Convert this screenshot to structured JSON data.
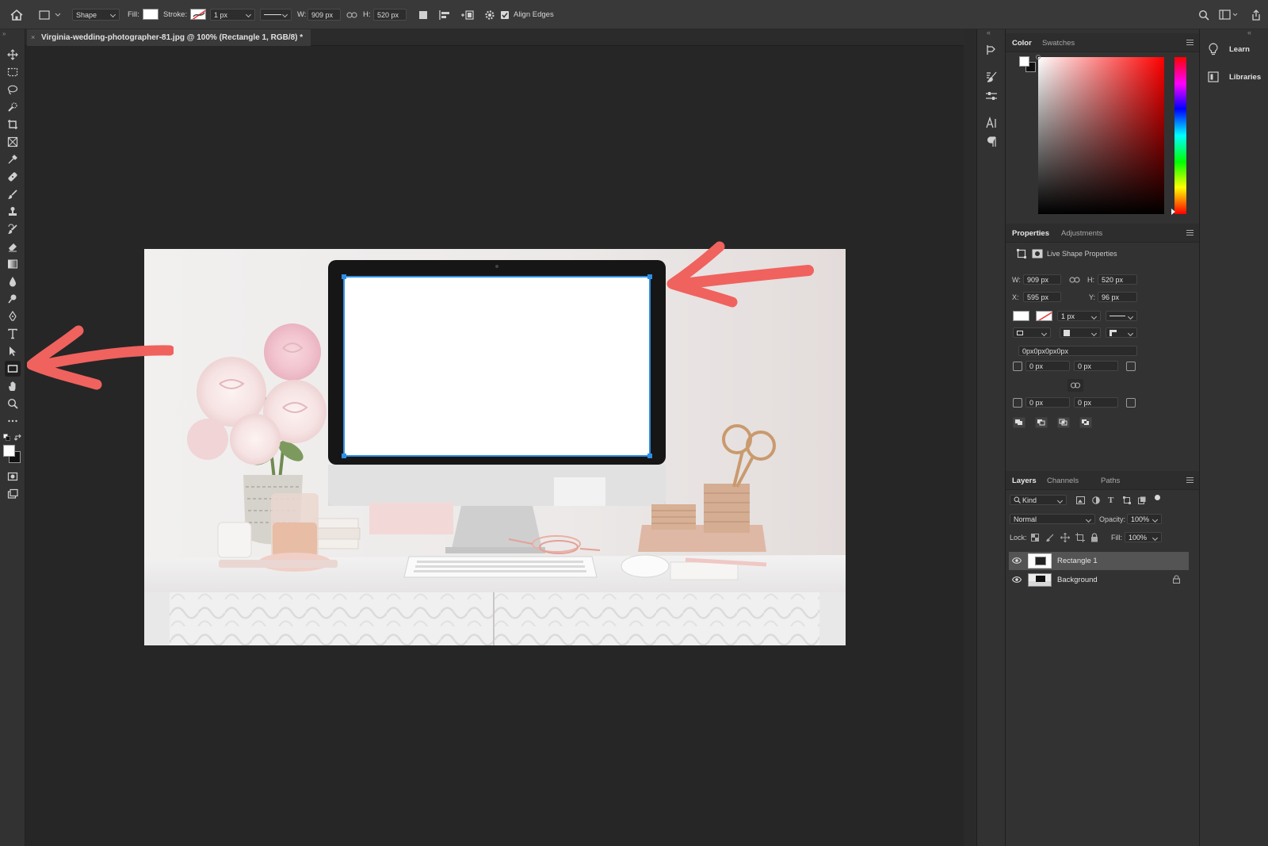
{
  "options_bar": {
    "mode": "Shape",
    "fill_label": "Fill:",
    "stroke_label": "Stroke:",
    "stroke_width": "1 px",
    "w_label": "W:",
    "w_value": "909 px",
    "h_label": "H:",
    "h_value": "520 px",
    "align_edges": "Align Edges"
  },
  "document": {
    "tab_title": "Virginia-wedding-photographer-81.jpg @ 100% (Rectangle 1, RGB/8) *",
    "close": "×"
  },
  "color_panel": {
    "tabs": [
      "Color",
      "Swatches"
    ]
  },
  "right_panel": {
    "learn": "Learn",
    "libraries": "Libraries"
  },
  "properties_panel": {
    "tabs": [
      "Properties",
      "Adjustments"
    ],
    "section": "Live Shape Properties",
    "w_label": "W:",
    "w_value": "909 px",
    "h_label": "H:",
    "h_value": "520 px",
    "x_label": "X:",
    "x_value": "595 px",
    "y_label": "Y:",
    "y_value": "96 px",
    "stroke_width": "1 px",
    "corner_summary": "0px0px0px0px",
    "corner_tl": "0 px",
    "corner_tr": "0 px",
    "corner_bl": "0 px",
    "corner_br": "0 px"
  },
  "layers_panel": {
    "tabs": [
      "Layers",
      "Channels",
      "Paths"
    ],
    "filter": "Kind",
    "blend_mode": "Normal",
    "opacity_label": "Opacity:",
    "opacity_value": "100%",
    "lock_label": "Lock:",
    "fill_label": "Fill:",
    "fill_value": "100%",
    "layers": [
      {
        "name": "Rectangle 1",
        "selected": true
      },
      {
        "name": "Background",
        "selected": false
      }
    ]
  },
  "colors": {
    "accent_arrow": "#f0625e",
    "selection_blue": "#2d8fe6",
    "canvas_bg": "#262626",
    "panel_bg": "#323232"
  }
}
